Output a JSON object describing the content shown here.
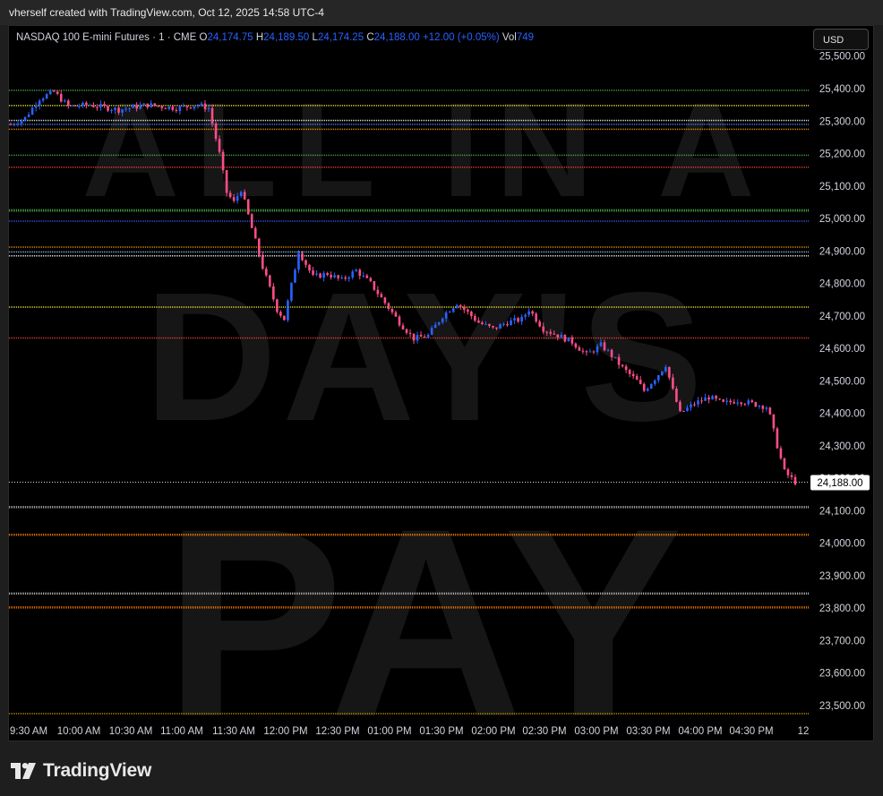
{
  "header": {
    "credit": "vherself created with TradingView.com, Oct 12, 2025 14:58 UTC-4"
  },
  "legend": {
    "symbol": "NASDAQ 100 E-mini Futures · 1 · CME",
    "o_label": "O",
    "o_value": "24,174.75",
    "h_label": "H",
    "h_value": "24,189.50",
    "l_label": "L",
    "l_value": "24,174.25",
    "c_label": "C",
    "c_value": "24,188.00",
    "change": "+12.00 (+0.05%)",
    "vol_label": "Vol",
    "vol_value": "749"
  },
  "currency_button": "USD",
  "watermark": [
    "ALL IN A",
    "DAY'S",
    "PAY"
  ],
  "footer": {
    "brand": "TradingView"
  },
  "colors": {
    "background": "#000000",
    "candle_up": "#2962ff",
    "candle_down": "#ff4d88",
    "axis_text": "#d1d4dc"
  },
  "chart_data": {
    "type": "candlestick",
    "title": "",
    "xlabel": "",
    "ylabel": "",
    "ylim": [
      23450,
      25520
    ],
    "x_ticks": [
      "9:30 AM",
      "10:00 AM",
      "10:30 AM",
      "11:00 AM",
      "11:30 AM",
      "12:00 PM",
      "12:30 PM",
      "01:00 PM",
      "01:30 PM",
      "02:00 PM",
      "02:30 PM",
      "03:00 PM",
      "03:30 PM",
      "04:00 PM",
      "04:30 PM",
      "12"
    ],
    "y_ticks": [
      25500,
      25400,
      25300,
      25200,
      25100,
      25000,
      24900,
      24800,
      24700,
      24600,
      24500,
      24400,
      24300,
      24200,
      24100,
      24000,
      23900,
      23800,
      23700,
      23600,
      23500
    ],
    "y_tick_labels": [
      "25,500.00",
      "25,400.00",
      "25,300.00",
      "25,200.00",
      "25,100.00",
      "25,000.00",
      "24,900.00",
      "24,800.00",
      "24,700.00",
      "24,600.00",
      "24,500.00",
      "24,400.00",
      "24,300.00",
      "24,200.00",
      "24,100.00",
      "24,000.00",
      "23,900.00",
      "23,800.00",
      "23,700.00",
      "23,600.00",
      "23,500.00"
    ],
    "last_price": 24188,
    "last_price_label": "24,188.00",
    "price_path": [
      [
        0,
        25290
      ],
      [
        4,
        25310
      ],
      [
        8,
        25370
      ],
      [
        12,
        25390
      ],
      [
        16,
        25345
      ],
      [
        22,
        25350
      ],
      [
        30,
        25335
      ],
      [
        38,
        25350
      ],
      [
        46,
        25340
      ],
      [
        52,
        25350
      ],
      [
        55,
        25340
      ],
      [
        58,
        25200
      ],
      [
        60,
        25080
      ],
      [
        62,
        25050
      ],
      [
        64,
        25090
      ],
      [
        66,
        25010
      ],
      [
        70,
        24850
      ],
      [
        74,
        24720
      ],
      [
        76,
        24690
      ],
      [
        80,
        24900
      ],
      [
        84,
        24820
      ],
      [
        88,
        24830
      ],
      [
        92,
        24810
      ],
      [
        96,
        24840
      ],
      [
        100,
        24800
      ],
      [
        104,
        24740
      ],
      [
        108,
        24680
      ],
      [
        112,
        24630
      ],
      [
        116,
        24640
      ],
      [
        120,
        24700
      ],
      [
        124,
        24740
      ],
      [
        126,
        24720
      ],
      [
        130,
        24680
      ],
      [
        134,
        24660
      ],
      [
        138,
        24680
      ],
      [
        142,
        24690
      ],
      [
        144,
        24720
      ],
      [
        148,
        24660
      ],
      [
        152,
        24640
      ],
      [
        156,
        24620
      ],
      [
        160,
        24580
      ],
      [
        164,
        24610
      ],
      [
        166,
        24590
      ],
      [
        170,
        24540
      ],
      [
        174,
        24500
      ],
      [
        176,
        24470
      ],
      [
        180,
        24520
      ],
      [
        182,
        24550
      ],
      [
        184,
        24470
      ],
      [
        186,
        24400
      ],
      [
        190,
        24430
      ],
      [
        194,
        24450
      ],
      [
        198,
        24430
      ],
      [
        202,
        24440
      ],
      [
        206,
        24430
      ],
      [
        210,
        24420
      ],
      [
        211,
        24390
      ],
      [
        213,
        24300
      ],
      [
        215,
        24220
      ],
      [
        218,
        24188
      ]
    ],
    "horizontal_levels": [
      {
        "price": 25395,
        "color": "#4caf50",
        "width": 1.5
      },
      {
        "price": 25348,
        "color": "#ffeb3b",
        "width": 1.5
      },
      {
        "price": 25302,
        "color": "#ffffff",
        "width": 1.5
      },
      {
        "price": 25290,
        "color": "#448aff",
        "width": 1.5
      },
      {
        "price": 25275,
        "color": "#ff9800",
        "width": 1.5
      },
      {
        "price": 25195,
        "color": "#4caf50",
        "width": 1.5
      },
      {
        "price": 25158,
        "color": "#f44336",
        "width": 1.5
      },
      {
        "price": 25025,
        "color": "#4caf50",
        "width": 3
      },
      {
        "price": 24992,
        "color": "#3d5afe",
        "width": 1.5
      },
      {
        "price": 24912,
        "color": "#ff9800",
        "width": 1.5
      },
      {
        "price": 24897,
        "color": "#90caf9",
        "width": 1.5
      },
      {
        "price": 24885,
        "color": "#ffffff",
        "width": 1.5
      },
      {
        "price": 24727,
        "color": "#ffeb3b",
        "width": 1.5
      },
      {
        "price": 24632,
        "color": "#f44336",
        "width": 1.5
      },
      {
        "price": 24111,
        "color": "#bdbdbd",
        "width": 2.5
      },
      {
        "price": 24026,
        "color": "#f57c00",
        "width": 2.5
      },
      {
        "price": 23845,
        "color": "#bdbdbd",
        "width": 2.5
      },
      {
        "price": 23802,
        "color": "#f57c00",
        "width": 2.5
      },
      {
        "price": 23475,
        "color": "#c8a000",
        "width": 1.5
      }
    ]
  }
}
